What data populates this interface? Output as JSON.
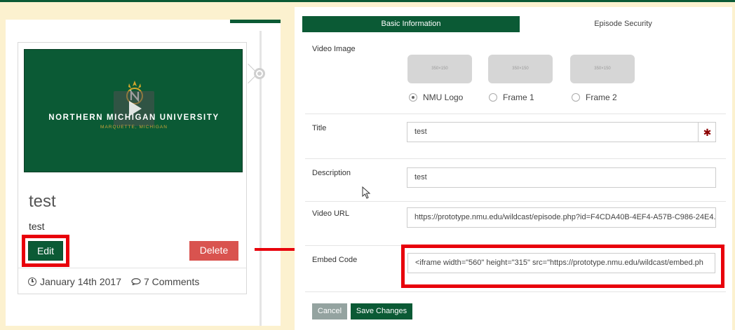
{
  "card": {
    "thumbnail_title": "NORTHERN MICHIGAN UNIVERSITY",
    "thumbnail_subtitle": "MARQUETTE, MICHIGAN",
    "title": "test",
    "description": "test",
    "edit_label": "Edit",
    "delete_label": "Delete",
    "date": "January 14th 2017",
    "comments": "7 Comments"
  },
  "form": {
    "tabs": [
      "Basic Information",
      "Episode Security"
    ],
    "video_image": {
      "label": "Video Image",
      "placeholders": [
        "350×150",
        "350×150",
        "350×150"
      ],
      "options": [
        "NMU Logo",
        "Frame 1",
        "Frame 2"
      ],
      "selected": "NMU Logo"
    },
    "title": {
      "label": "Title",
      "value": "test",
      "required_mark": "✱"
    },
    "description": {
      "label": "Description",
      "value": "test"
    },
    "video_url": {
      "label": "Video URL",
      "value": "https://prototype.nmu.edu/wildcast/episode.php?id=F4CDA40B-4EF4-A57B-C986-24E4..."
    },
    "embed_code": {
      "label": "Embed Code",
      "value": "<iframe width=\"560\" height=\"315\" src=\"https://prototype.nmu.edu/wildcast/embed.ph"
    },
    "cancel_label": "Cancel",
    "save_label": "Save Changes"
  },
  "colors": {
    "nmu_green": "#0b5a35",
    "highlight_red": "#e8000b",
    "background": "#fcf1cf",
    "delete_red": "#d9534f"
  }
}
